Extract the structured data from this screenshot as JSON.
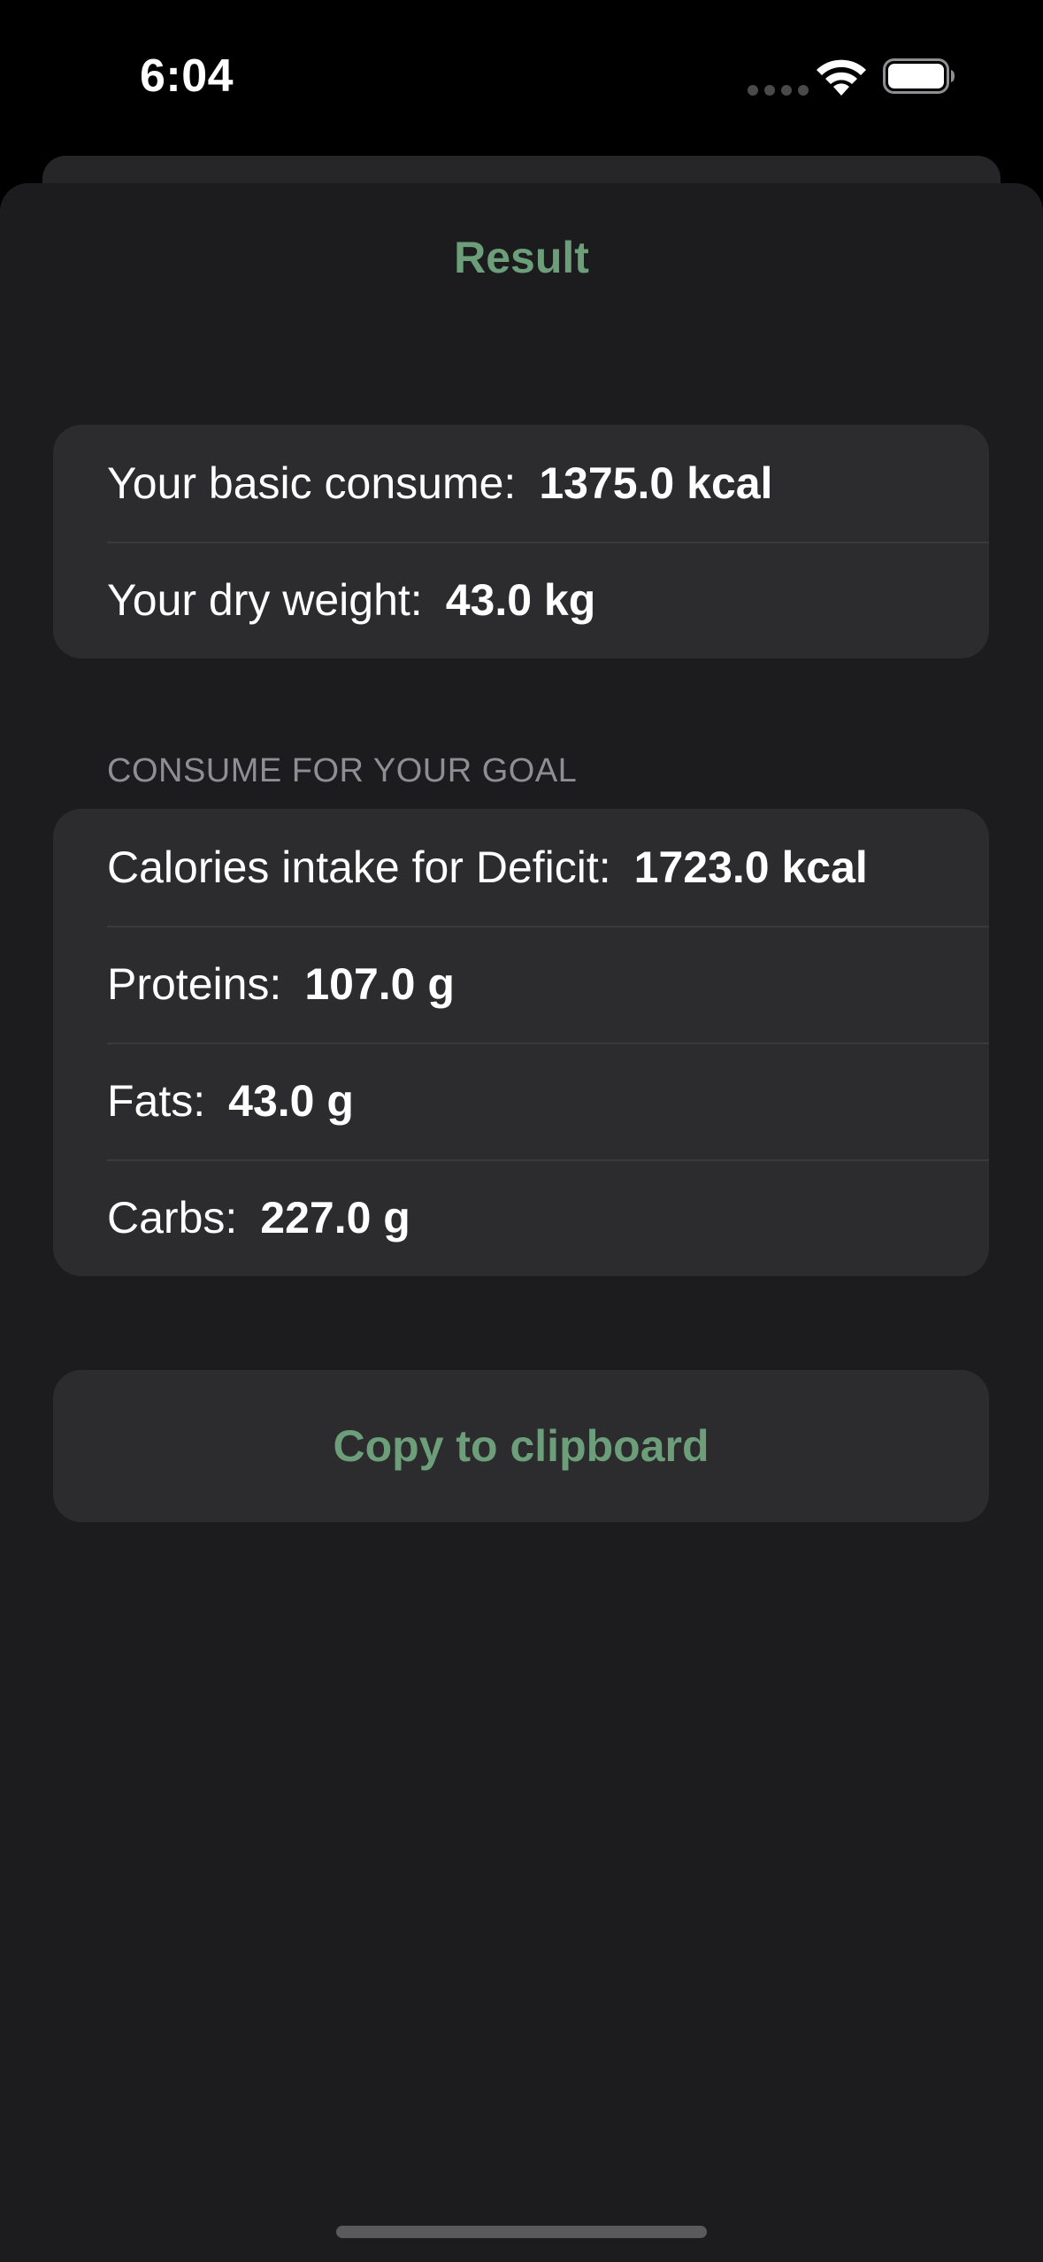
{
  "status_bar": {
    "time": "6:04",
    "icons": [
      "signal-dots-icon",
      "wifi-icon",
      "battery-icon"
    ]
  },
  "sheet": {
    "title": "Result"
  },
  "basic_group": {
    "rows": [
      {
        "label": "Your basic consume:",
        "value": "1375.0 kcal"
      },
      {
        "label": "Your dry weight:",
        "value": "43.0 kg"
      }
    ]
  },
  "goal_group": {
    "header": "CONSUME FOR YOUR GOAL",
    "rows": [
      {
        "label": "Calories intake for Deficit:",
        "value": "1723.0 kcal"
      },
      {
        "label": "Proteins:",
        "value": "107.0 g"
      },
      {
        "label": "Fats:",
        "value": "43.0 g"
      },
      {
        "label": "Carbs:",
        "value": "227.0 g"
      }
    ]
  },
  "actions": {
    "copy_label": "Copy to clipboard"
  },
  "colors": {
    "accent": "#6c9e7a",
    "background": "#1c1c1e",
    "card": "#2c2c2e",
    "secondary_text": "#8e8e93"
  }
}
